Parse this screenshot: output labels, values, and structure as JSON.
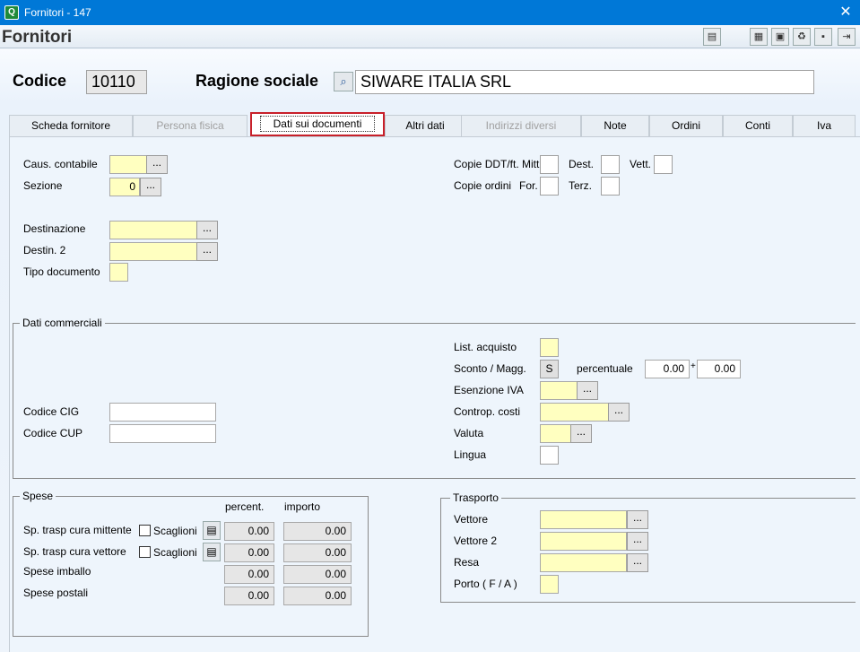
{
  "window": {
    "title": "Fornitori - 147",
    "app_icon": "Q",
    "close_glyph": "✕"
  },
  "header": {
    "title": "Fornitori"
  },
  "top": {
    "codice_label": "Codice",
    "codice_value": "10110",
    "ragione_label": "Ragione sociale",
    "ragione_value": "SIWARE ITALIA SRL"
  },
  "tabs": [
    {
      "label": "Scheda fornitore"
    },
    {
      "label": "Persona fisica"
    },
    {
      "label": "Dati sui documenti"
    },
    {
      "label": "Altri dati"
    },
    {
      "label": "Indirizzi diversi"
    },
    {
      "label": "Note"
    },
    {
      "label": "Ordini"
    },
    {
      "label": "Conti"
    },
    {
      "label": "Iva"
    }
  ],
  "documenti": {
    "caus_contabile": "Caus. contabile",
    "sezione": "Sezione",
    "sezione_value": "0",
    "destinazione": "Destinazione",
    "destin2": "Destin. 2",
    "tipo_documento": "Tipo documento",
    "copie_ddt": "Copie DDT/ft. Mitt.",
    "dest": "Dest.",
    "vett": "Vett.",
    "copie_ordini": "Copie ordini",
    "for": "For.",
    "terz": "Terz.",
    "dots": "..."
  },
  "commerciali": {
    "title": "Dati commerciali",
    "list_acquisto": "List. acquisto",
    "sconto_magg": "Sconto / Magg.",
    "sconto_value": "S",
    "percentuale": "percentuale",
    "perc1": "0.00",
    "plus": "+",
    "perc2": "0.00",
    "esenzione_iva": "Esenzione IVA",
    "controp_costi": "Controp. costi",
    "valuta": "Valuta",
    "lingua": "Lingua",
    "codice_cig": "Codice CIG",
    "codice_cup": "Codice CUP"
  },
  "spese": {
    "title": "Spese",
    "col_percent": "percent.",
    "col_importo": "importo",
    "scaglioni": "Scaglioni",
    "rows": [
      {
        "label": "Sp. trasp cura mittente",
        "percent": "0.00",
        "importo": "0.00"
      },
      {
        "label": "Sp. trasp cura vettore",
        "percent": "0.00",
        "importo": "0.00"
      },
      {
        "label": "Spese imballo",
        "percent": "0.00",
        "importo": "0.00"
      },
      {
        "label": "Spese postali",
        "percent": "0.00",
        "importo": "0.00"
      }
    ]
  },
  "trasporto": {
    "title": "Trasporto",
    "vettore": "Vettore",
    "vettore2": "Vettore 2",
    "resa": "Resa",
    "porto": "Porto ( F / A )"
  }
}
